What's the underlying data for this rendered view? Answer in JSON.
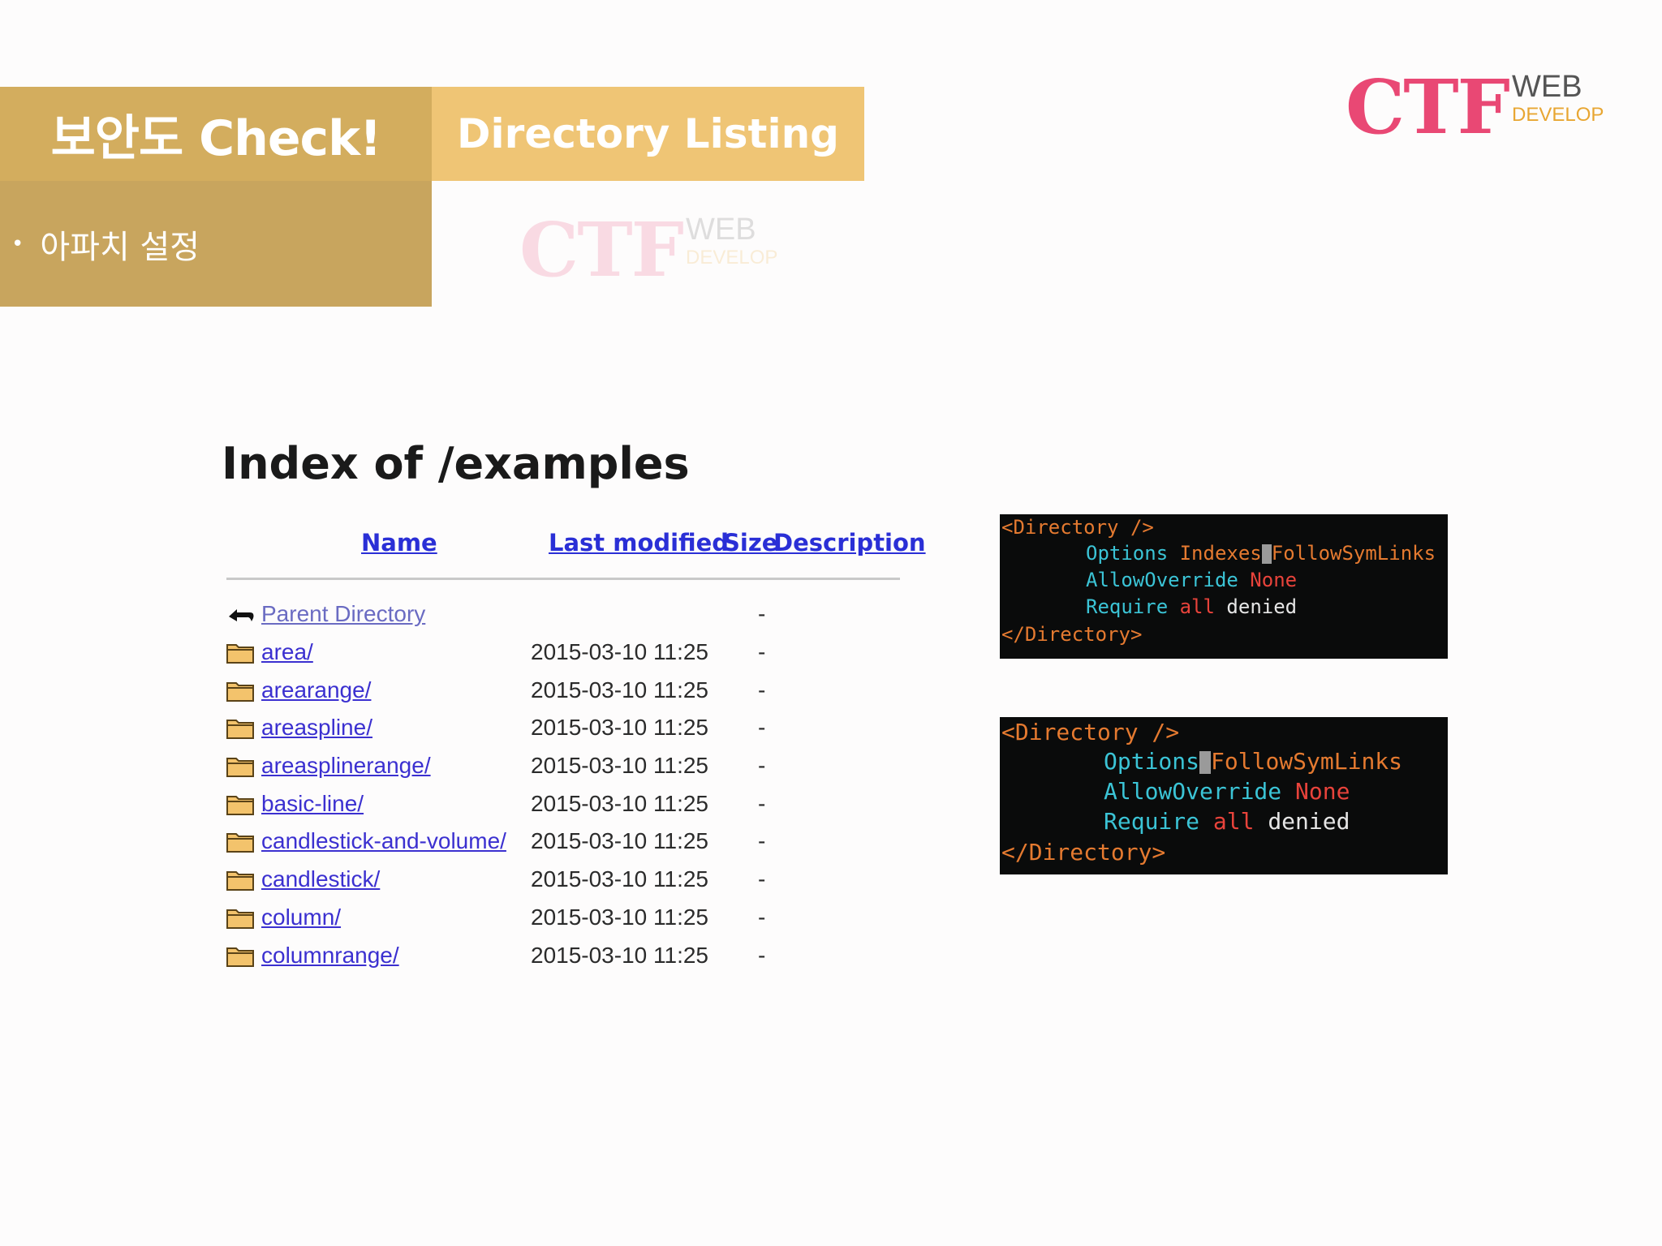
{
  "slide": {
    "title": "보안도 Check!",
    "subtitle": "Directory Listing",
    "bullet": "아파치 설정"
  },
  "logo": {
    "ctf": "CTF",
    "web": "WEB",
    "develop": "DEVELOP"
  },
  "colors": {
    "title_bg": "#d3ad5e",
    "subtitle_bg": "#efc575",
    "bullet_bg": "#c8a55e",
    "logo_pink": "#e94874",
    "logo_gold": "#e8a632",
    "link_blue": "#3b30d0",
    "code_bg": "#0a0b0b"
  },
  "index_listing": {
    "title": "Index of /examples",
    "columns": {
      "name": "Name",
      "last_modified": "Last modified",
      "size": "Size",
      "description": "Description"
    },
    "rows": [
      {
        "icon": "back-arrow-icon",
        "name": "Parent Directory",
        "date": "",
        "size": "-"
      },
      {
        "icon": "folder-icon",
        "name": "area/",
        "date": "2015-03-10 11:25",
        "size": "-"
      },
      {
        "icon": "folder-icon",
        "name": "arearange/",
        "date": "2015-03-10 11:25",
        "size": "-"
      },
      {
        "icon": "folder-icon",
        "name": "areaspline/",
        "date": "2015-03-10 11:25",
        "size": "-"
      },
      {
        "icon": "folder-icon",
        "name": "areasplinerange/",
        "date": "2015-03-10 11:25",
        "size": "-"
      },
      {
        "icon": "folder-icon",
        "name": "basic-line/",
        "date": "2015-03-10 11:25",
        "size": "-"
      },
      {
        "icon": "folder-icon",
        "name": "candlestick-and-volume/",
        "date": "2015-03-10 11:25",
        "size": "-"
      },
      {
        "icon": "folder-icon",
        "name": "candlestick/",
        "date": "2015-03-10 11:25",
        "size": "-"
      },
      {
        "icon": "folder-icon",
        "name": "column/",
        "date": "2015-03-10 11:25",
        "size": "-"
      },
      {
        "icon": "folder-icon",
        "name": "columnrange/",
        "date": "2015-03-10 11:25",
        "size": "-"
      }
    ]
  },
  "code_before": {
    "open_tag": "<Directory />",
    "options_kw": "Options",
    "options_val1": "Indexes",
    "options_val2": "FollowSymLinks",
    "override_kw": "AllowOverride",
    "override_val": "None",
    "require_kw": "Require",
    "require_all": "all",
    "require_val": "denied",
    "close_tag": "</Directory>"
  },
  "code_after": {
    "open_tag": "<Directory />",
    "options_kw": "Options",
    "options_val": "FollowSymLinks",
    "override_kw": "AllowOverride",
    "override_val": "None",
    "require_kw": "Require",
    "require_all": "all",
    "require_val": "denied",
    "close_tag": "</Directory>"
  }
}
